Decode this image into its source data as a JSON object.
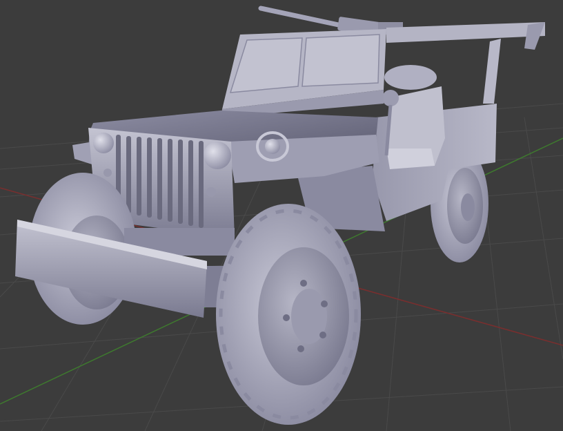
{
  "viewport": {
    "background_color": "#3c3c3c",
    "grid_color": "#4a4a4a",
    "x_axis_color": "#7a2e2e",
    "y_axis_color": "#3e7a2e"
  },
  "model": {
    "subject": "military-jeep",
    "material_color": "#a8a8bc",
    "shadow_color": "#6d6d82",
    "highlight_color": "#d2d2de"
  }
}
